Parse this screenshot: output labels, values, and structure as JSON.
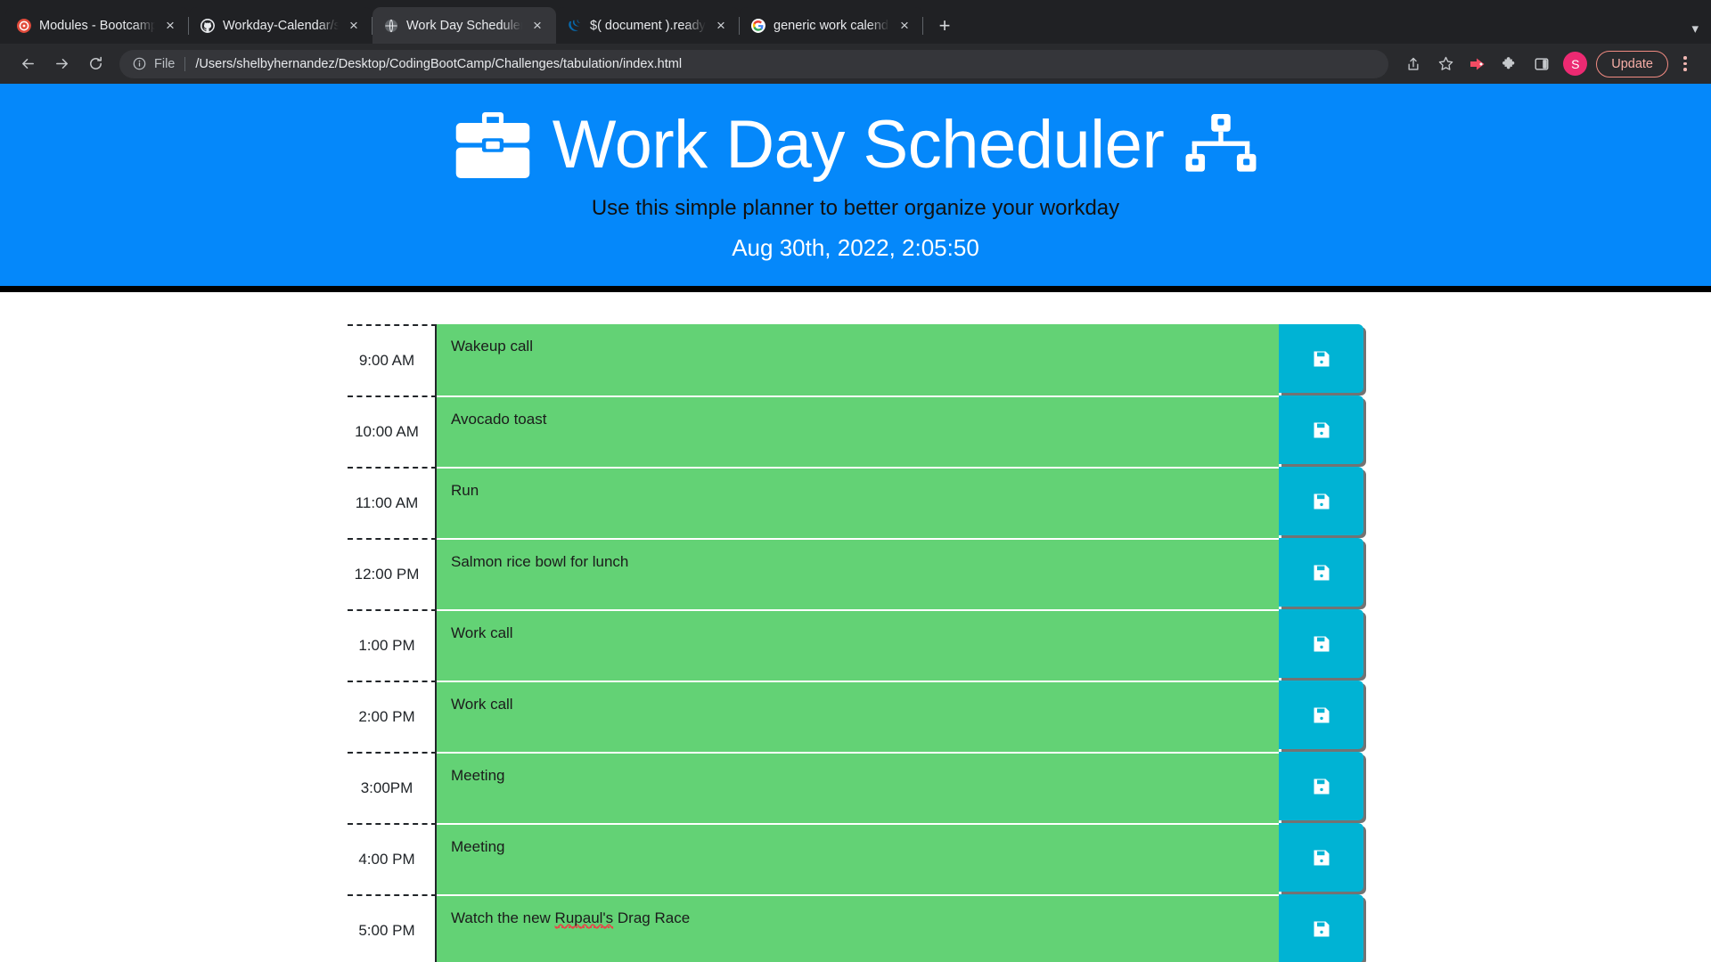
{
  "browser": {
    "tabs": [
      {
        "title": "Modules - Bootcamp: UTA-VIR",
        "favicon": "canvas-icon",
        "active": false
      },
      {
        "title": "Workday-Calendar/script.js at m",
        "favicon": "github-icon",
        "active": false
      },
      {
        "title": "Work Day Scheduler",
        "favicon": "globe-icon",
        "active": true
      },
      {
        "title": "$( document ).ready() | jQuery",
        "favicon": "jquery-icon",
        "active": false
      },
      {
        "title": "generic work calendar - Google",
        "favicon": "google-icon",
        "active": false
      }
    ],
    "new_tab_label": "+",
    "tab_list_chevron": "chevron-down-icon",
    "close_label": "×",
    "toolbar": {
      "back_label": "back-arrow-icon",
      "forward_label": "forward-arrow-icon",
      "reload_label": "reload-icon",
      "omnibox": {
        "info_icon": "info-circle-icon",
        "scheme_label": "File",
        "url": "/Users/shelbyhernandez/Desktop/CodingBootCamp/Challenges/tabulation/index.html"
      },
      "share_icon": "share-icon",
      "bookmark_icon": "star-icon",
      "extension_red_icon": "red-arrow-extension-icon",
      "extensions_icon": "puzzle-piece-icon",
      "side_panel_icon": "side-panel-icon",
      "avatar_label": "S",
      "update_label": "Update",
      "menu_icon": "kebab-menu-icon"
    }
  },
  "page": {
    "title": "Work Day Scheduler",
    "title_left_icon": "briefcase-icon",
    "title_right_icon": "sitemap-icon",
    "subtitle": "Use this simple planner to better organize your workday",
    "current_day": "Aug 30th, 2022, 2:05:50",
    "colors": {
      "header_blue": "#0588fa",
      "block_green": "#63d275",
      "save_cyan": "#00b3d4",
      "rule_black": "#000000"
    },
    "save_icon": "floppy-disk-save-icon",
    "time_blocks": [
      {
        "hour": "9:00 AM",
        "text": "Wakeup call"
      },
      {
        "hour": "10:00 AM",
        "text": "Avocado toast"
      },
      {
        "hour": "11:00 AM",
        "text": "Run"
      },
      {
        "hour": "12:00 PM",
        "text": "Salmon rice bowl for lunch"
      },
      {
        "hour": "1:00 PM",
        "text": "Work call"
      },
      {
        "hour": "2:00 PM",
        "text": "Work call"
      },
      {
        "hour": "3:00PM",
        "text": "Meeting"
      },
      {
        "hour": "4:00 PM",
        "text": "Meeting"
      },
      {
        "hour": "5:00 PM",
        "text": "Watch the new Rupaul's Drag Race",
        "misspelled_word": "Rupaul's"
      }
    ]
  }
}
